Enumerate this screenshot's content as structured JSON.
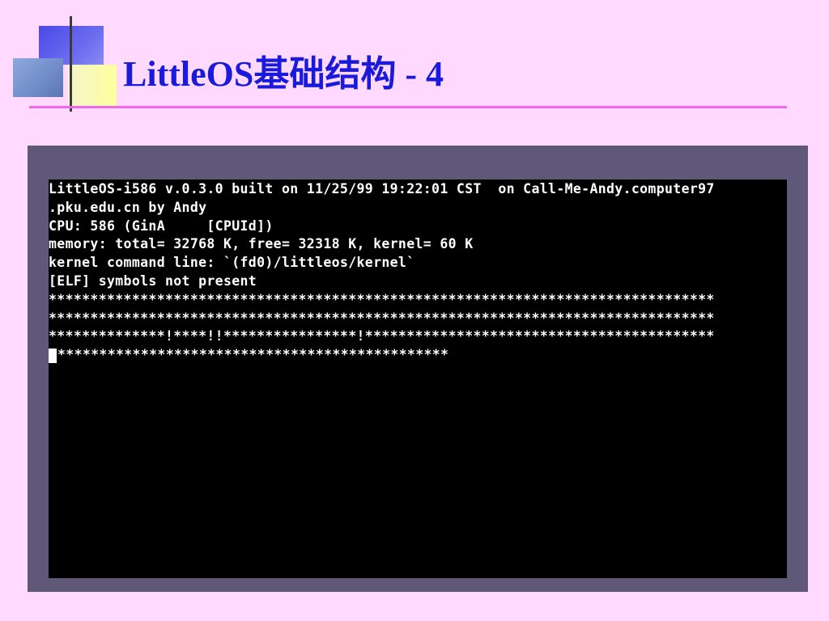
{
  "slide": {
    "title": "LittleOS基础结构 - 4",
    "colors": {
      "background": "#FFD9FF",
      "title": "#1A1ADC",
      "rule": "#F266EE",
      "frame": "#5F5879",
      "console_bg": "#000000",
      "console_text": "#FFFFFF"
    }
  },
  "console": {
    "lines": [
      "LittleOS-i586 v.0.3.0 built on 11/25/99 19:22:01 CST  on Call-Me-Andy.computer97",
      ".pku.edu.cn by Andy",
      "CPU: 586 (GinA     [CPUId])",
      "memory: total= 32768 K, free= 32318 K, kernel= 60 K",
      "kernel command line: `(fd0)/littleos/kernel`",
      "[ELF] symbols not present",
      "********************************************************************************",
      "********************************************************************************",
      "**************!****!!****************!******************************************",
      "***********************************************"
    ]
  }
}
